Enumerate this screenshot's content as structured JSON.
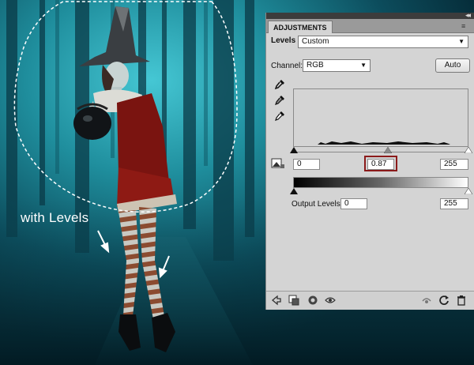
{
  "canvas": {
    "caption": "with Levels",
    "colors": {
      "fog": "#2aa9b8",
      "forest_dark": "#07303c",
      "dress": "#7f1410",
      "skin": "#c7d6d6"
    }
  },
  "panel": {
    "tab_label": "ADJUSTMENTS",
    "collapse_glyph": "◂◂",
    "menu_glyph": "≡",
    "levels_label": "Levels",
    "preset_value": "Custom",
    "channel_label": "Channel:",
    "channel_value": "RGB",
    "auto_label": "Auto",
    "input_black": "0",
    "input_gamma": "0.87",
    "input_white": "255",
    "output_label": "Output Levels:",
    "output_black": "0",
    "output_white": "255",
    "icons": {
      "eyedroppers": [
        "black-point-eyedropper-icon",
        "gray-point-eyedropper-icon",
        "white-point-eyedropper-icon"
      ],
      "bottom": [
        "back-icon",
        "clip-to-layer-icon",
        "visibility-eye-icon",
        "view-previous-icon",
        "reset-icon",
        "delete-icon"
      ]
    },
    "highlight_color": "#8b1a1a"
  }
}
